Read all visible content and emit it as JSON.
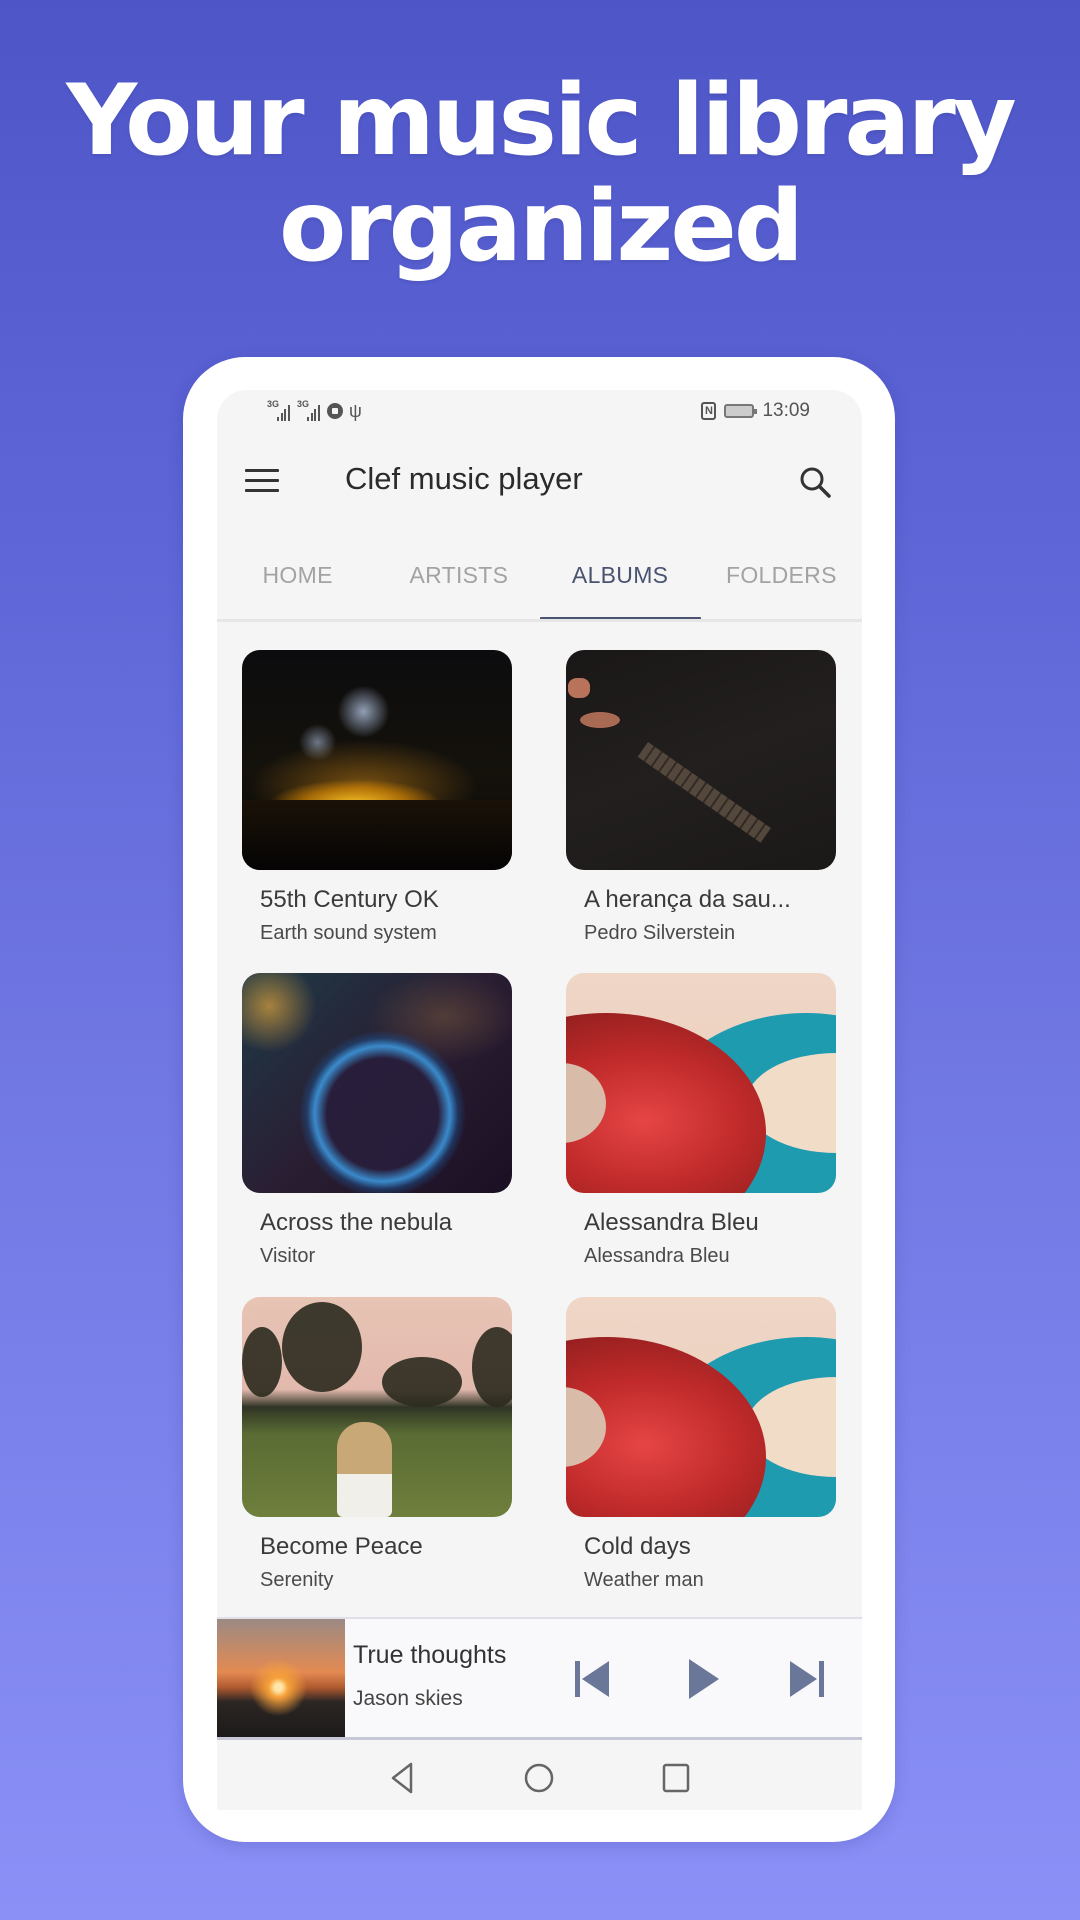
{
  "headline": {
    "line1": "Your music library",
    "line2": "organized"
  },
  "status_bar": {
    "network_1": "3G",
    "network_2": "3G",
    "time": "13:09",
    "icons": [
      "signal-icon",
      "signal-icon",
      "audio-icon",
      "usb-icon",
      "nfc-icon",
      "battery-icon"
    ]
  },
  "app_bar": {
    "title": "Clef music player",
    "menu_icon": "hamburger-menu-icon",
    "search_icon": "search-icon"
  },
  "tabs": [
    {
      "label": "HOME",
      "active": false
    },
    {
      "label": "ARTISTS",
      "active": false
    },
    {
      "label": "ALBUMS",
      "active": true
    },
    {
      "label": "FOLDERS",
      "active": false
    }
  ],
  "albums": [
    {
      "title": "55th Century OK",
      "artist": "Earth sound system",
      "art": "concert-crowd"
    },
    {
      "title": "A herança da sau...",
      "artist": "Pedro Silverstein",
      "art": "piano-hands"
    },
    {
      "title": "Across the nebula",
      "artist": "Visitor",
      "art": "nebula"
    },
    {
      "title": "Alessandra Bleu",
      "artist": "Alessandra Bleu",
      "art": "vinyl-records"
    },
    {
      "title": "Become Peace",
      "artist": "Serenity",
      "art": "field-girl"
    },
    {
      "title": "Cold days",
      "artist": "Weather man",
      "art": "vinyl-records"
    }
  ],
  "now_playing": {
    "title": "True thoughts",
    "artist": "Jason skies",
    "art": "sunset-mountains",
    "controls": [
      "skip-previous-icon",
      "play-icon",
      "skip-next-icon"
    ]
  },
  "nav_bar": {
    "buttons": [
      "back-icon",
      "home-icon",
      "recents-icon"
    ]
  },
  "colors": {
    "accent": "#4a5470",
    "control": "#6b7799",
    "background_top": "#4d55c7",
    "background_bottom": "#8a90f6"
  }
}
